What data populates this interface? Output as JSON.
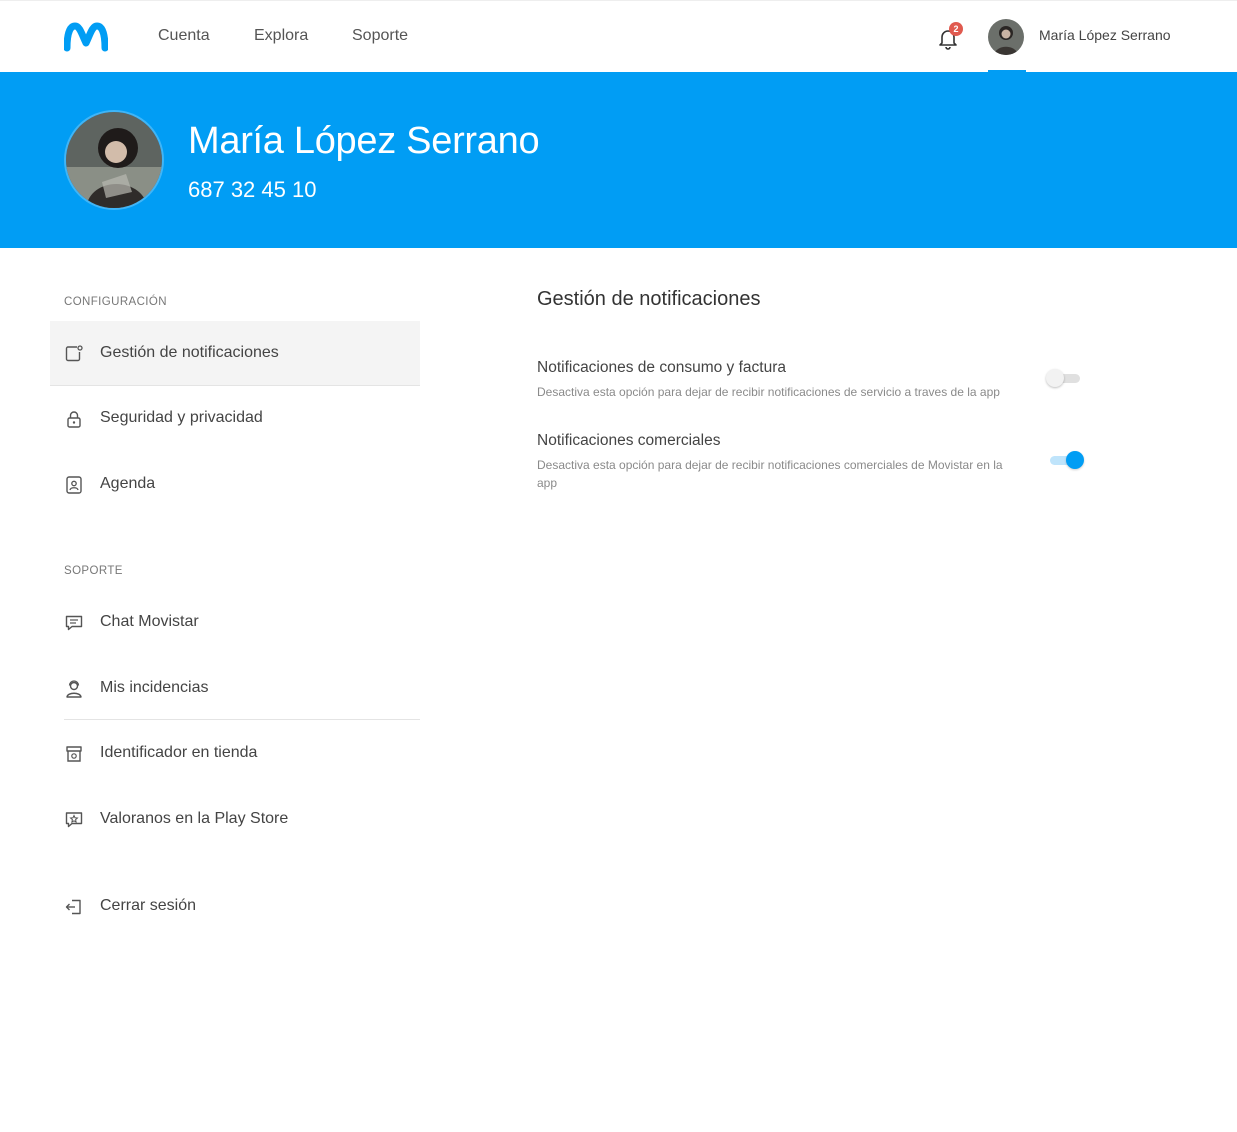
{
  "brand": {
    "logo_icon": "movistar-m-logo",
    "accent": "#019df4",
    "alert": "#e05a4f"
  },
  "nav": {
    "links": [
      "Cuenta",
      "Explora",
      "Soporte"
    ],
    "notifications_count": "2",
    "user_name": "María López Serrano"
  },
  "profile": {
    "name": "María López Serrano",
    "phone": "687 32 45 10"
  },
  "sidebar": {
    "config_title": "CONFIGURACIÓN",
    "config_items": [
      {
        "label": "Gestión de notificaciones",
        "icon": "notification-settings-icon"
      },
      {
        "label": "Seguridad y privacidad",
        "icon": "lock-icon"
      },
      {
        "label": "Agenda",
        "icon": "contacts-icon"
      }
    ],
    "support_title": "SOPORTE",
    "support_items": [
      {
        "label": "Chat Movistar",
        "icon": "chat-icon"
      },
      {
        "label": "Mis incidencias",
        "icon": "support-agent-icon"
      },
      {
        "label": "Identificador en tienda",
        "icon": "store-icon"
      },
      {
        "label": "Valoranos en la Play Store",
        "icon": "rate-icon"
      }
    ],
    "logout": {
      "label": "Cerrar sesión",
      "icon": "logout-icon"
    }
  },
  "main": {
    "title": "Gestión de notificaciones",
    "settings": [
      {
        "title": "Notificaciones de consumo y factura",
        "description": "Desactiva esta opción para dejar de recibir notificaciones de servicio a traves de la app",
        "enabled": false
      },
      {
        "title": "Notificaciones comerciales",
        "description": "Desactiva esta opción para dejar de recibir notificaciones comerciales de Movistar en la app",
        "enabled": true
      }
    ]
  }
}
